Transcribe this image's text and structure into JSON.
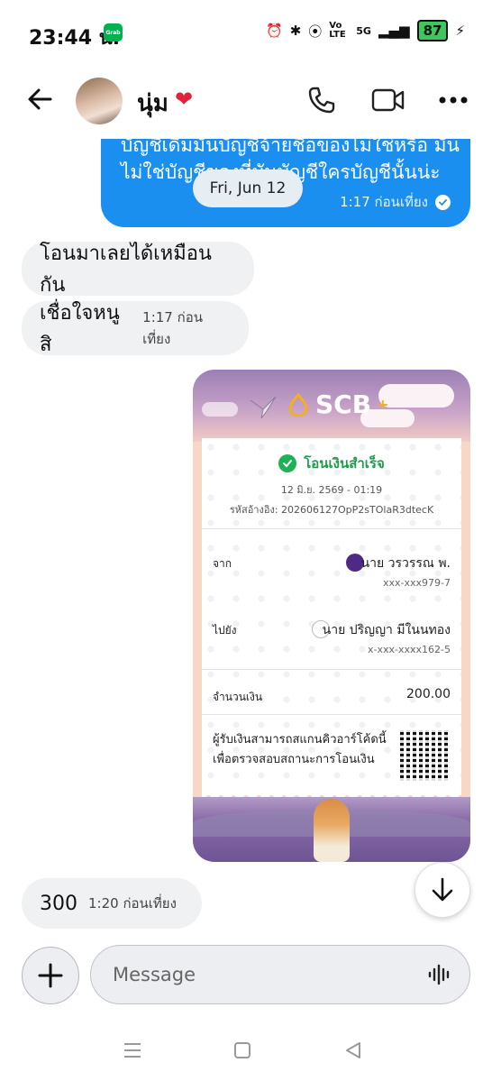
{
  "status_bar": {
    "time": "23:44 น.",
    "grab_label": "Grab",
    "network": "5G",
    "volte": "Vo LTE",
    "battery": "87"
  },
  "header": {
    "contact_name": "นุ่ม",
    "heart": "❤"
  },
  "messages": {
    "out_partial_text": "บัญชีเดิมมันบัญชีจ้ายชื่อของไม่ใช่หรือ มันไม่ใช่บัญชีของที่มันบัญชีใครบัญชีนั้นน่ะ",
    "out_partial_time": "1:17 ก่อนเที่ยง",
    "date_separator": "Fri, Jun 12",
    "in_1": "โอนมาเลยได้เหมือนกัน",
    "in_2": "เชื่อใจหนูสิ",
    "in_2_time": "1:17 ก่อนเที่ยง",
    "in_3": "300",
    "in_3_time": "1:20 ก่อนเที่ยง"
  },
  "receipt": {
    "brand": "SCB",
    "status": "โอนเงินสำเร็จ",
    "datetime": "12 มิ.ย. 2569 - 01:19",
    "reference": "รหัสอ้างอิง: 202606127OpP2sTOlaR3dtecK",
    "from_label": "จาก",
    "from_name": "นาย วรวรรณ พ.",
    "from_account": "xxx-xxx979-7",
    "to_label": "ไปยัง",
    "to_name": "นาย ปริญญา มีในนทอง",
    "to_account": "x-xxx-xxxx162-5",
    "amount_label": "จำนวนเงิน",
    "amount": "200.00",
    "qr_text_1": "ผู้รับเงินสามารถสแกนคิวอาร์โค้ดนี้",
    "qr_text_2": "เพื่อตรวจสอบสถานะการโอนเงิน"
  },
  "composer": {
    "placeholder": "Message"
  }
}
